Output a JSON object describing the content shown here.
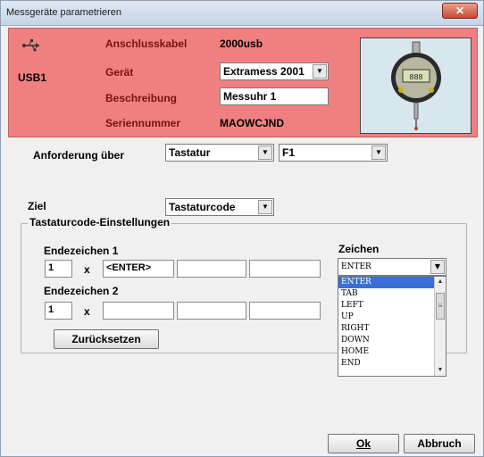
{
  "window": {
    "title": "Messgeräte parametrieren",
    "close_label": "✕"
  },
  "header": {
    "usb_name": "USB1",
    "cable_label": "Anschlusskabel",
    "cable_value": "2000usb",
    "device_label": "Gerät",
    "device_value": "Extramess 2001",
    "description_label": "Beschreibung",
    "description_value": "Messuhr 1",
    "serial_label": "Seriennummer",
    "serial_value": "MAOWCJND",
    "colors": {
      "background": "#f08080"
    }
  },
  "request": {
    "label": "Anforderung über",
    "source_value": "Tastatur",
    "key_value": "F1"
  },
  "target": {
    "label": "Ziel",
    "value": "Tastaturcode"
  },
  "keyboard_settings": {
    "title": "Tastaturcode-Einstellungen",
    "end1_label": "Endezeichen 1",
    "end1_count": "1",
    "end1_x": "x",
    "end1_fields": [
      "<ENTER>",
      "",
      ""
    ],
    "end2_label": "Endezeichen 2",
    "end2_count": "1",
    "end2_x": "x",
    "end2_fields": [
      "",
      "",
      ""
    ],
    "chars_label": "Zeichen",
    "chars_selected": "ENTER",
    "chars_options": [
      "ENTER",
      "TAB",
      "LEFT",
      "UP",
      "RIGHT",
      "DOWN",
      "HOME",
      "END"
    ],
    "reset_label": "Zurücksetzen"
  },
  "footer": {
    "ok_label": "Ok",
    "cancel_label": "Abbruch"
  }
}
